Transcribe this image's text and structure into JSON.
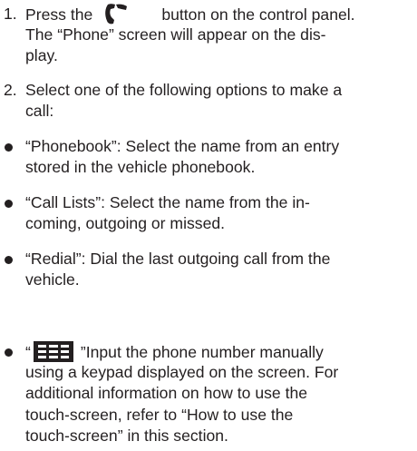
{
  "steps": [
    {
      "number": "1.",
      "lines": [
        {
          "before": "Press the",
          "icon": "phone-icon",
          "after": "button on the control panel."
        },
        {
          "text": "The “Phone” screen will appear on the dis-"
        },
        {
          "text": "play."
        }
      ]
    },
    {
      "number": "2.",
      "lines": [
        {
          "text": "Select one of the following options to make a"
        },
        {
          "text": "call:"
        }
      ]
    }
  ],
  "bullets": [
    {
      "lines": [
        "“Phonebook”: Select the name from an entry",
        "stored in the vehicle phonebook."
      ]
    },
    {
      "lines": [
        "“Call Lists”: Select the name from the in-",
        "coming, outgoing or missed."
      ]
    },
    {
      "lines": [
        "“Redial”: Dial the last outgoing call from the",
        "vehicle."
      ]
    },
    {
      "first_line": {
        "open_quote": "“",
        "icon": "keypad-icon",
        "after": "”Input the phone number manually"
      },
      "lines": [
        "using a keypad displayed on the screen. For",
        "additional information on how to use the",
        "touch-screen, refer to “How to use the",
        "touch-screen” in this section."
      ]
    }
  ]
}
